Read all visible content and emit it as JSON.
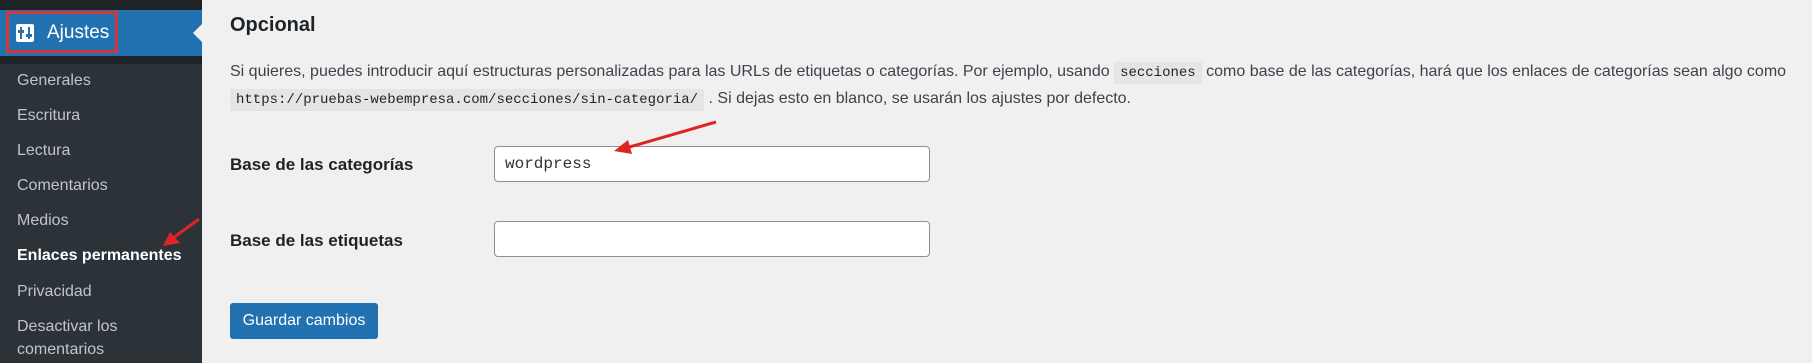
{
  "sidebar": {
    "active_menu": {
      "label": "Ajustes",
      "icon": "settings-sliders-icon"
    },
    "submenu": [
      {
        "label": "Generales"
      },
      {
        "label": "Escritura"
      },
      {
        "label": "Lectura"
      },
      {
        "label": "Comentarios"
      },
      {
        "label": "Medios"
      },
      {
        "label": "Enlaces permanentes",
        "current": true
      },
      {
        "label": "Privacidad"
      },
      {
        "label": "Desactivar los"
      },
      {
        "label": "comentarios"
      }
    ]
  },
  "main": {
    "section_title": "Opcional",
    "description": {
      "part1": "Si quieres, puedes introducir aquí estructuras personalizadas para las URLs de etiquetas o categorías. Por ejemplo, usando ",
      "code1": "secciones",
      "part2": " como base de las categorías, hará que los enlaces de categorías sean algo como ",
      "code2": "https://pruebas-webempresa.com/secciones/sin-categoria/",
      "part3": " . Si dejas esto en blanco, se usarán los ajustes por defecto."
    },
    "category_base": {
      "label": "Base de las categorías",
      "value": "wordpress"
    },
    "tag_base": {
      "label": "Base de las etiquetas",
      "value": ""
    },
    "save_button": "Guardar cambios"
  },
  "colors": {
    "accent": "#2271b1",
    "annotation": "#e02424",
    "sidebar_bg": "#1d2327"
  }
}
